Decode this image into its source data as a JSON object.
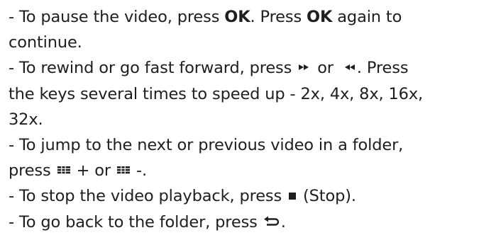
{
  "instructions": {
    "pause": {
      "t1": "- To pause the video, press ",
      "ok1": "OK",
      "t2": ". Press ",
      "ok2": "OK",
      "t3": " again to",
      "t4": "continue."
    },
    "rewind": {
      "t1": "- To rewind or go fast forward, press ",
      "t2": " or ",
      "t3": ". Press",
      "t4": "the keys several times to speed up - 2x, 4x, 8x, 16x,",
      "t5": "32x."
    },
    "jump": {
      "t1": "- To jump to the next or previous video in a folder,",
      "t2": "press ",
      "t3": " + or ",
      "t4": " -."
    },
    "stop": {
      "t1": "- To stop the video playback, press ",
      "t2": " (Stop)."
    },
    "back": {
      "t1": "- To go back to the folder, press ",
      "t2": "."
    }
  },
  "icons": {
    "fast_forward": "fast-forward-icon",
    "rewind": "rewind-icon",
    "list": "list-icon",
    "stop": "stop-icon",
    "back": "back-icon"
  },
  "colors": {
    "text": "#1e1e1e"
  }
}
